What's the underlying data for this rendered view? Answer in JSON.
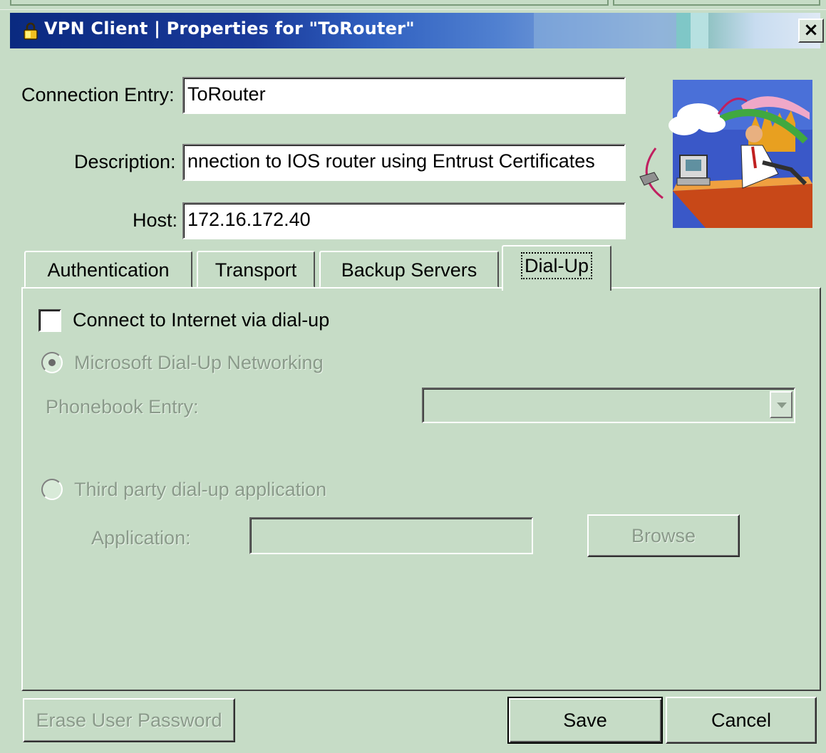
{
  "window": {
    "title": "VPN Client  |  Properties for \"ToRouter\"",
    "close_glyph": "×",
    "icon": "lock-icon"
  },
  "form": {
    "connection_entry_label": "Connection Entry:",
    "connection_entry_value": "ToRouter",
    "description_label": "Description:",
    "description_value": "nnection to IOS router using Entrust Certificates",
    "host_label": "Host:",
    "host_value": "172.16.172.40"
  },
  "tabs": [
    {
      "label": "Authentication",
      "active": false
    },
    {
      "label": "Transport",
      "active": false
    },
    {
      "label": "Backup Servers",
      "active": false
    },
    {
      "label": "Dial-Up",
      "active": true
    }
  ],
  "dialup": {
    "connect_checkbox_label": "Connect to Internet via dial-up",
    "connect_checked": false,
    "ms_radio_label": "Microsoft Dial-Up Networking",
    "ms_radio_selected": true,
    "phonebook_label": "Phonebook Entry:",
    "phonebook_value": "",
    "third_party_radio_label": "Third party dial-up application",
    "third_party_selected": false,
    "application_label": "Application:",
    "application_value": "",
    "browse_label": "Browse"
  },
  "footer": {
    "erase_label": "Erase User Password",
    "save_label": "Save",
    "cancel_label": "Cancel"
  },
  "colors": {
    "background": "#c6dcc6",
    "title_start": "#0a2a80",
    "disabled_text": "#8a9a8a"
  }
}
